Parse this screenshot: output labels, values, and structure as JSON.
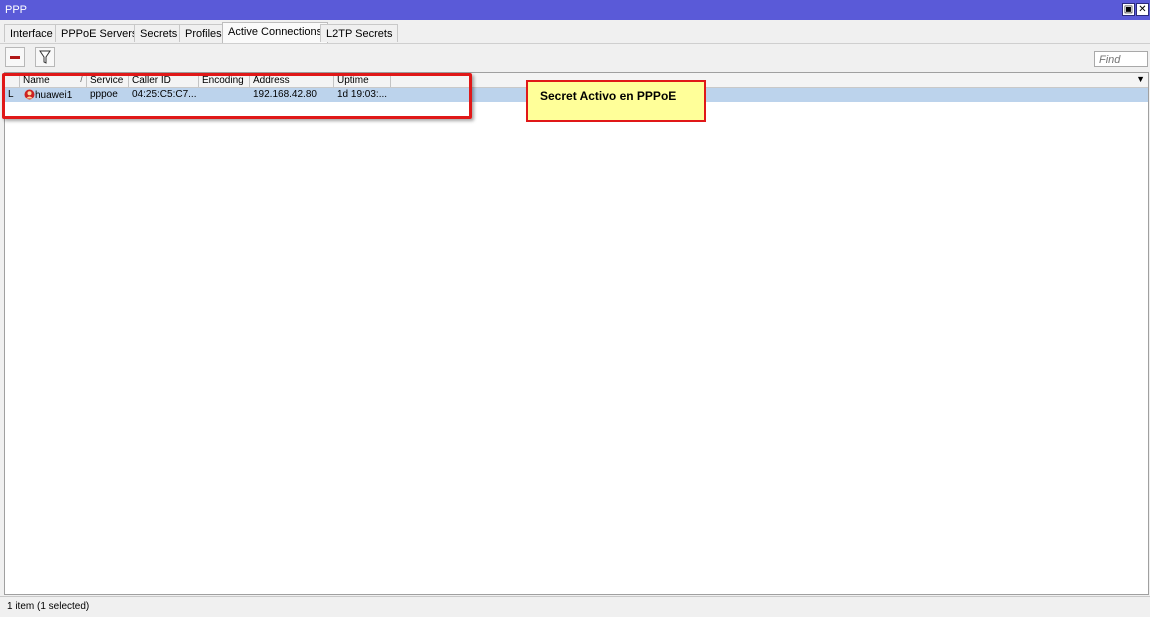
{
  "window": {
    "title": "PPP"
  },
  "tabs": [
    {
      "label": "Interface"
    },
    {
      "label": "PPPoE Servers"
    },
    {
      "label": "Secrets"
    },
    {
      "label": "Profiles"
    },
    {
      "label": "Active Connections",
      "active": true
    },
    {
      "label": "L2TP Secrets"
    }
  ],
  "toolbar": {
    "find_placeholder": "Find"
  },
  "table": {
    "columns": [
      "Name",
      "Service",
      "Caller ID",
      "Encoding",
      "Address",
      "Uptime"
    ],
    "rows": [
      {
        "flag": "L",
        "name": "huawei1",
        "service": "pppoe",
        "caller_id": "04:25:C5:C7...",
        "encoding": "",
        "address": "192.168.42.80",
        "uptime": "1d 19:03:..."
      }
    ]
  },
  "status": {
    "text": "1 item (1 selected)"
  },
  "annotation": {
    "text": "Secret Activo en PPPoE"
  },
  "colors": {
    "title_bar": "#5a5ad8",
    "selected_row": "#bcd3ec",
    "annotation_border": "#e01818",
    "annotation_fill": "#ffff99"
  }
}
